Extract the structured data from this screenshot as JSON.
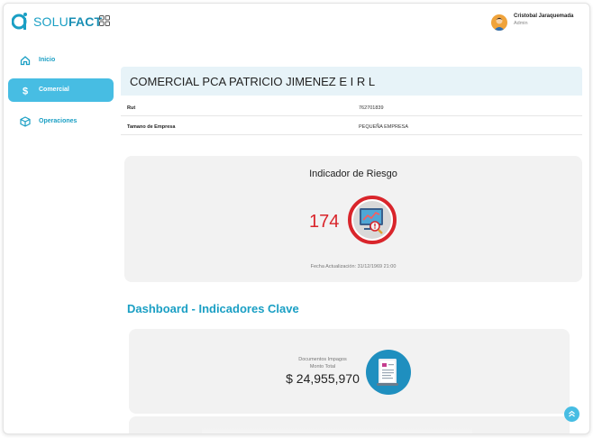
{
  "brand": {
    "name_part1": "SOLU",
    "name_part2": "FACT",
    "primary_color": "#1a9fc4",
    "accent_color": "#47bde3"
  },
  "user": {
    "name": "Cristobal Jaraquemada",
    "role": "Admin"
  },
  "sidebar": {
    "items": [
      {
        "label": "Inicio",
        "icon": "home-icon",
        "active": false
      },
      {
        "label": "Comercial",
        "icon": "dollar-icon",
        "active": true
      },
      {
        "label": "Operaciones",
        "icon": "box-icon",
        "active": false
      }
    ]
  },
  "company": {
    "name": "COMERCIAL PCA PATRICIO JIMENEZ E I R L",
    "rows": [
      {
        "key": "Rut",
        "value": "762701839"
      },
      {
        "key": "Tamano de Empresa",
        "value": "PEQUEÑA EMPRESA"
      }
    ]
  },
  "risk": {
    "title": "Indicador de Riesgo",
    "value": "174",
    "value_color": "#d9252b",
    "updated": "Fecha Actualización: 31/12/1969 21:00"
  },
  "dashboard": {
    "title": "Dashboard - Indicadores Clave",
    "kpis": [
      {
        "label1": "Documentos Impagos",
        "label2": "Monto Total",
        "amount": "$ 24,955,970",
        "icon": "document-icon"
      }
    ]
  }
}
